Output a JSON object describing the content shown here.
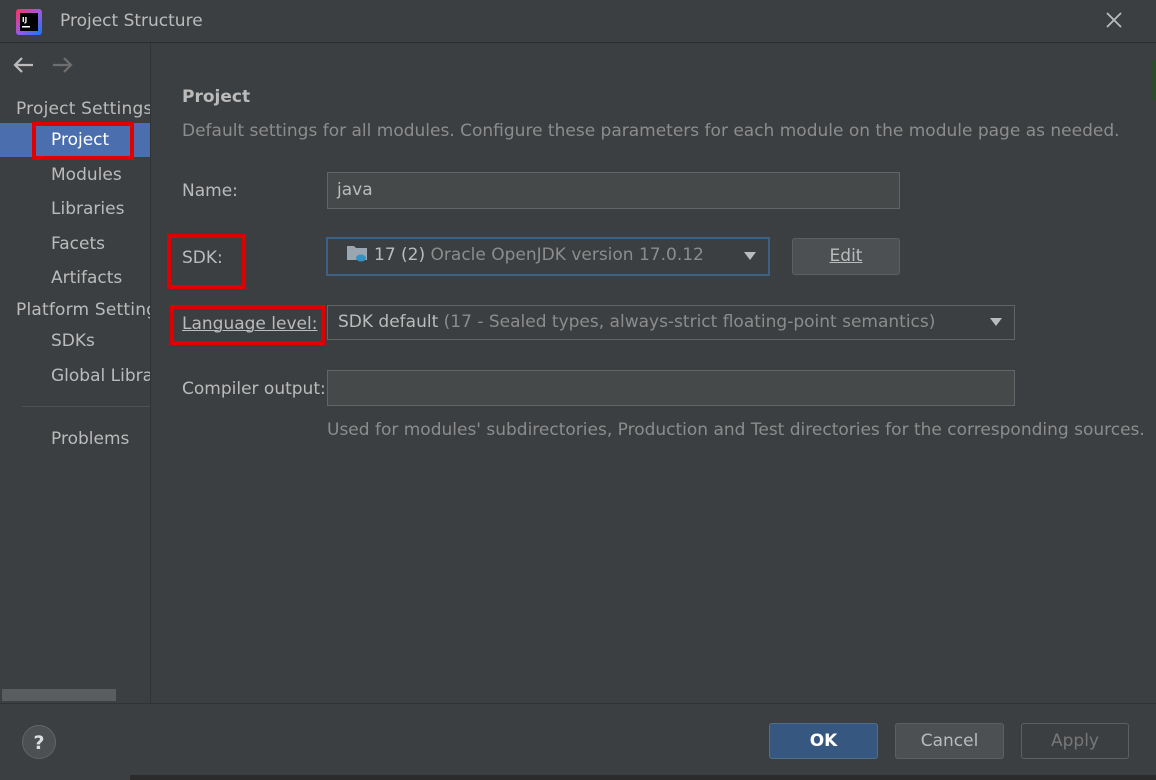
{
  "window": {
    "title": "Project Structure",
    "logo_text": "IJ"
  },
  "sidebar": {
    "project_settings_header": "Project Settings",
    "platform_settings_header": "Platform Settings",
    "items": [
      {
        "label": "Project"
      },
      {
        "label": "Modules"
      },
      {
        "label": "Libraries"
      },
      {
        "label": "Facets"
      },
      {
        "label": "Artifacts"
      },
      {
        "label": "SDKs"
      },
      {
        "label": "Global Libraries"
      },
      {
        "label": "Problems"
      }
    ]
  },
  "main": {
    "title": "Project",
    "description": "Default settings for all modules. Configure these parameters for each module on the module page as needed.",
    "name_label": "Name:",
    "name_value": "java",
    "sdk_label": "SDK:",
    "sdk_main": "17 (2)",
    "sdk_sub": "Oracle OpenJDK version 17.0.12",
    "edit_button": "Edit",
    "language_label": "Language level:",
    "language_main": "SDK default",
    "language_sub": "(17 - Sealed types, always-strict floating-point semantics)",
    "compiler_label": "Compiler output:",
    "compiler_value": "",
    "compiler_hint": "Used for modules' subdirectories, Production and Test directories for the corresponding sources."
  },
  "footer": {
    "help": "?",
    "ok": "OK",
    "cancel": "Cancel",
    "apply": "Apply"
  },
  "colors": {
    "background": "#3c3f41",
    "selection": "#4b6eaf",
    "primary_button": "#365880",
    "highlight_box": "#e00000"
  },
  "icons": [
    "intellij-logo-icon",
    "close-icon",
    "back-arrow-icon",
    "forward-arrow-icon",
    "folder-jdk-icon",
    "chevron-down-icon",
    "folder-browse-icon",
    "help-icon"
  ]
}
